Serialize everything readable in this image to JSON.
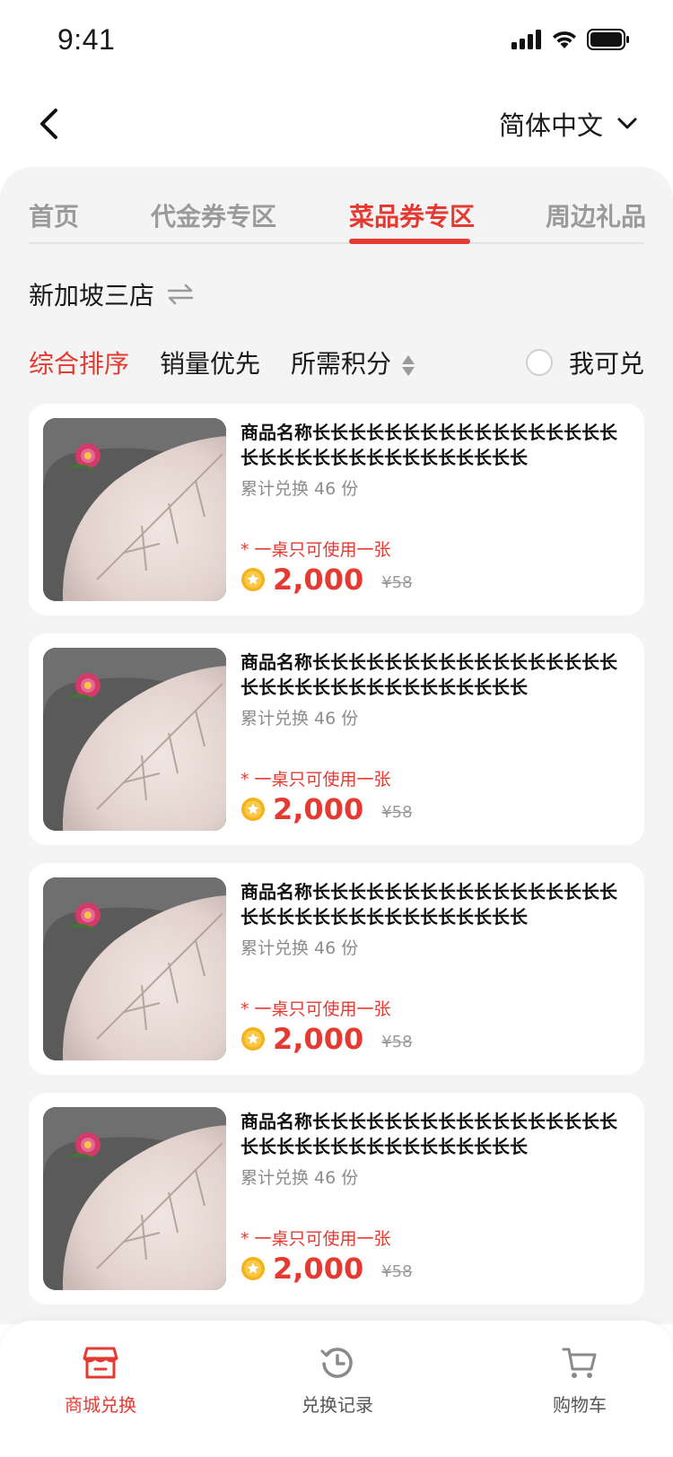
{
  "status_bar": {
    "time": "9:41"
  },
  "nav": {
    "language": "简体中文"
  },
  "tabs": [
    {
      "label": "首页"
    },
    {
      "label": "代金券专区"
    },
    {
      "label": "菜品券专区"
    },
    {
      "label": "周边礼品"
    }
  ],
  "active_tab_index": 2,
  "store": {
    "name": "新加坡三店"
  },
  "sort": {
    "options": [
      {
        "label": "综合排序"
      },
      {
        "label": "销量优先"
      },
      {
        "label": "所需积分"
      }
    ],
    "active_index": 0,
    "redeemable_label": "我可兑"
  },
  "products": [
    {
      "name": "商品名称长长长长长长长长长长长长长长长长长长长长长长长长长长长长长长长长长",
      "sold": "累计兑换 46 份",
      "limit": "* 一桌只可使用一张",
      "points": "2,000",
      "original_price": "¥58"
    },
    {
      "name": "商品名称长长长长长长长长长长长长长长长长长长长长长长长长长长长长长长长长长",
      "sold": "累计兑换 46 份",
      "limit": "* 一桌只可使用一张",
      "points": "2,000",
      "original_price": "¥58"
    },
    {
      "name": "商品名称长长长长长长长长长长长长长长长长长长长长长长长长长长长长长长长长长",
      "sold": "累计兑换 46 份",
      "limit": "* 一桌只可使用一张",
      "points": "2,000",
      "original_price": "¥58"
    },
    {
      "name": "商品名称长长长长长长长长长长长长长长长长长长长长长长长长长长长长长长长长长",
      "sold": "累计兑换 46 份",
      "limit": "* 一桌只可使用一张",
      "points": "2,000",
      "original_price": "¥58"
    }
  ],
  "bottom_tabs": [
    {
      "label": "商城兑换",
      "icon": "shop-icon"
    },
    {
      "label": "兑换记录",
      "icon": "history-icon"
    },
    {
      "label": "购物车",
      "icon": "cart-icon"
    }
  ],
  "bottom_active_index": 0,
  "colors": {
    "accent": "#e53a32",
    "background": "#f4f4f4",
    "coin": "#f5b21b"
  }
}
